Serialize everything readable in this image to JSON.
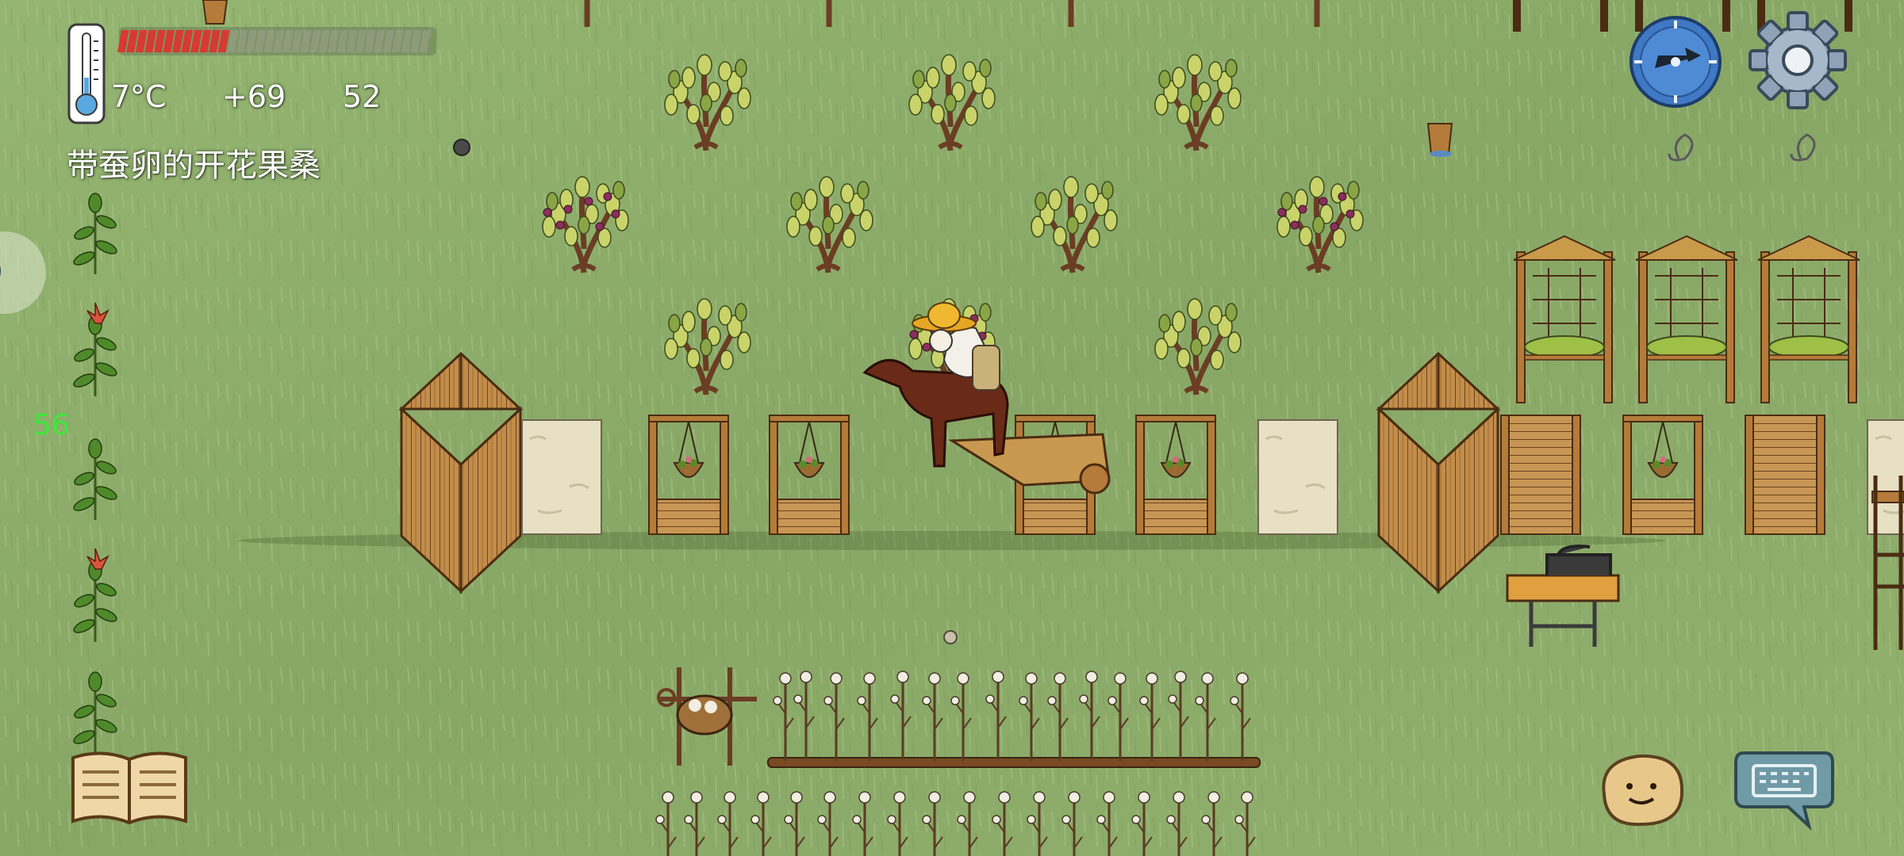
{
  "hud": {
    "temperature": "7°C",
    "heat_bonus": "+69",
    "food_count": "52",
    "health_fraction": 0.36,
    "hovered_object_label": "带蚕卵的开花果桑",
    "fps": "56"
  },
  "icons": {
    "thermometer": "thermometer-icon",
    "compass": "compass-icon",
    "settings": "gear-icon",
    "recipe_book": "open-book-icon",
    "emote": "smiley-potato-icon",
    "keyboard": "keyboard-speech-bubble-icon"
  },
  "colors": {
    "grass": "#8fae6c",
    "health_fill": "#d63a32",
    "health_empty": "#9aa08e",
    "fps_text": "#3ee83e",
    "compass_blue": "#3f78c4",
    "wood": "#b07a3a"
  }
}
